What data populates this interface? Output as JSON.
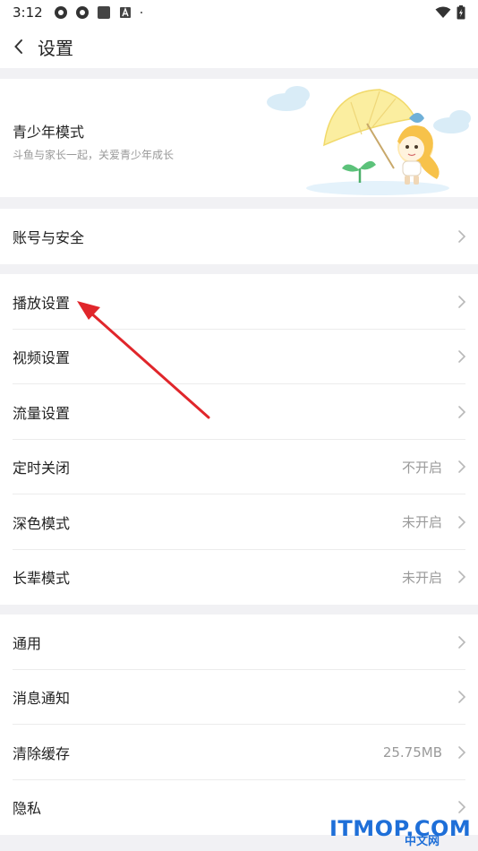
{
  "status_bar": {
    "time": "3:12"
  },
  "header": {
    "title": "设置"
  },
  "youth_mode": {
    "title": "青少年模式",
    "subtitle": "斗鱼与家长一起，关爱青少年成长"
  },
  "section1": {
    "items": [
      {
        "label": "账号与安全",
        "value": ""
      }
    ]
  },
  "section2": {
    "items": [
      {
        "label": "播放设置",
        "value": ""
      },
      {
        "label": "视频设置",
        "value": ""
      },
      {
        "label": "流量设置",
        "value": ""
      },
      {
        "label": "定时关闭",
        "value": "不开启"
      },
      {
        "label": "深色模式",
        "value": "未开启"
      },
      {
        "label": "长辈模式",
        "value": "未开启"
      }
    ]
  },
  "section3": {
    "items": [
      {
        "label": "通用",
        "value": ""
      },
      {
        "label": "消息通知",
        "value": ""
      },
      {
        "label": "清除缓存",
        "value": "25.75MB"
      },
      {
        "label": "隐私",
        "value": ""
      }
    ]
  },
  "watermark": {
    "text": "ITMOP.COM",
    "sub": "中文网"
  },
  "colors": {
    "accent_arrow": "#e0262b",
    "background": "#f1f1f4",
    "value_text": "#9a9a9a"
  }
}
